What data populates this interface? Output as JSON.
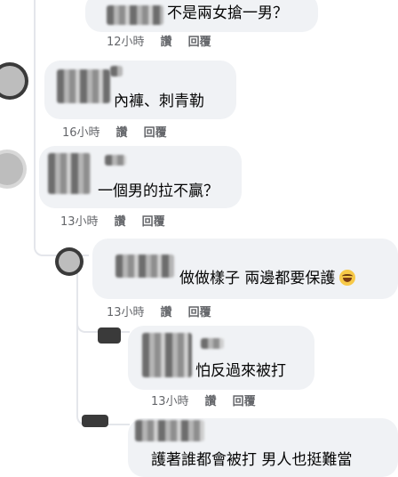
{
  "comments": [
    {
      "text": "不是兩女搶一男？",
      "time": "12小時",
      "like": "讚",
      "reply": "回覆"
    },
    {
      "text": "內褲、刺青勒",
      "time": "16小時",
      "like": "讚",
      "reply": "回覆"
    },
    {
      "text": "一個男的拉不贏？",
      "time": "13小時",
      "like": "讚",
      "reply": "回覆"
    },
    {
      "text": "做做樣子 兩邊都要保護",
      "emoji": "laughing-emoji",
      "time": "13小時",
      "like": "讚",
      "reply": "回覆"
    },
    {
      "text": "怕反過來被打",
      "time": "13小時",
      "like": "讚",
      "reply": "回覆"
    },
    {
      "text": "護著誰都會被打 男人也挺難當"
    }
  ]
}
